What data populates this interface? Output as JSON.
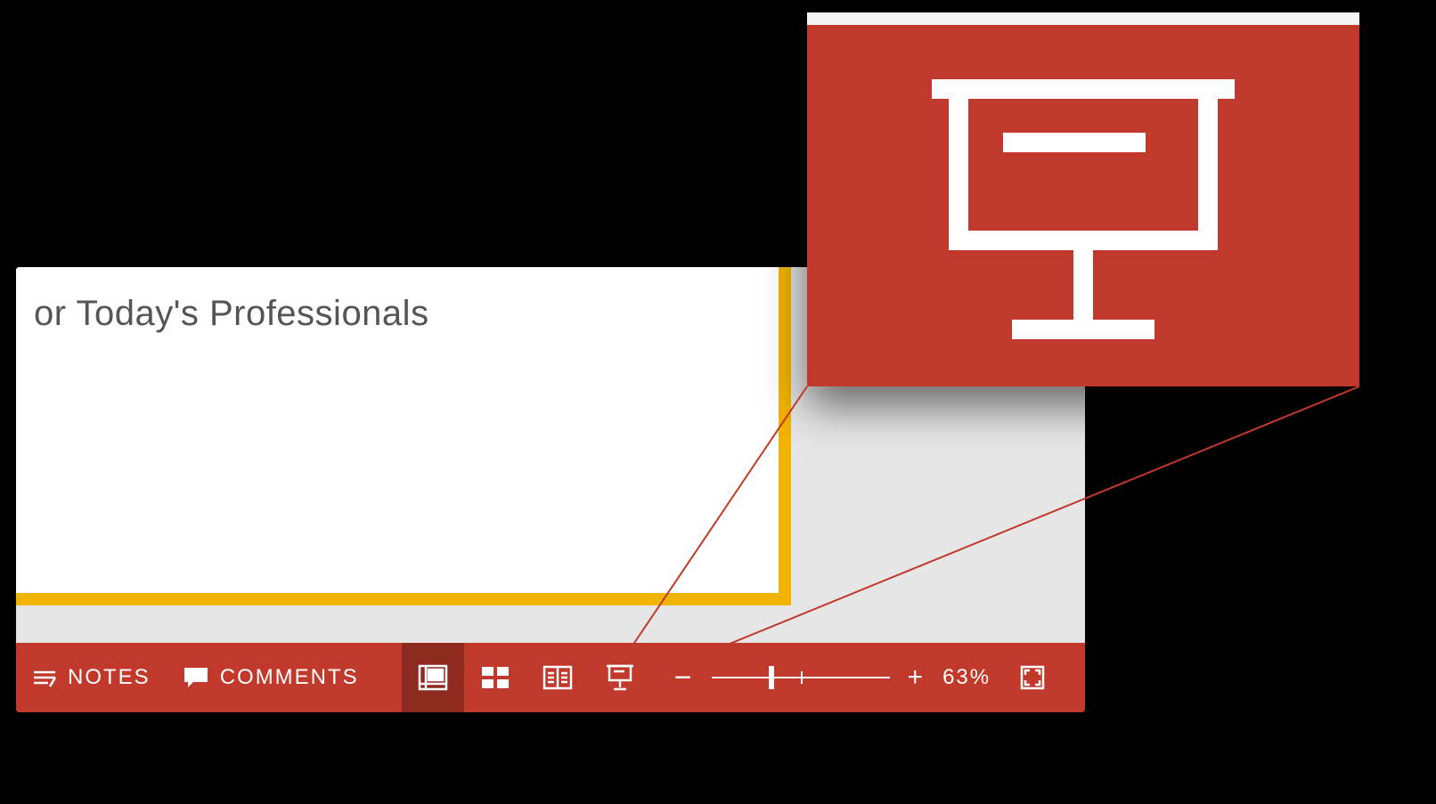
{
  "slide": {
    "text_fragment": "or Today's Professionals"
  },
  "statusbar": {
    "notes_label": "NOTES",
    "comments_label": "COMMENTS",
    "zoom_percent_label": "63%",
    "zoom_minus": "−",
    "zoom_plus": "+"
  },
  "icons": {
    "notes": "notes-icon",
    "comments": "comments-icon",
    "normal_view": "normal-view-icon",
    "slide_sorter": "slide-sorter-icon",
    "reading_view": "reading-view-icon",
    "slideshow": "slideshow-icon",
    "fit": "fit-window-icon"
  },
  "callout": {
    "highlighted_icon": "slideshow-icon"
  },
  "colors": {
    "accent": "#c0392b",
    "accent_dark": "#8e2a20",
    "slide_accent": "#f0b400"
  }
}
